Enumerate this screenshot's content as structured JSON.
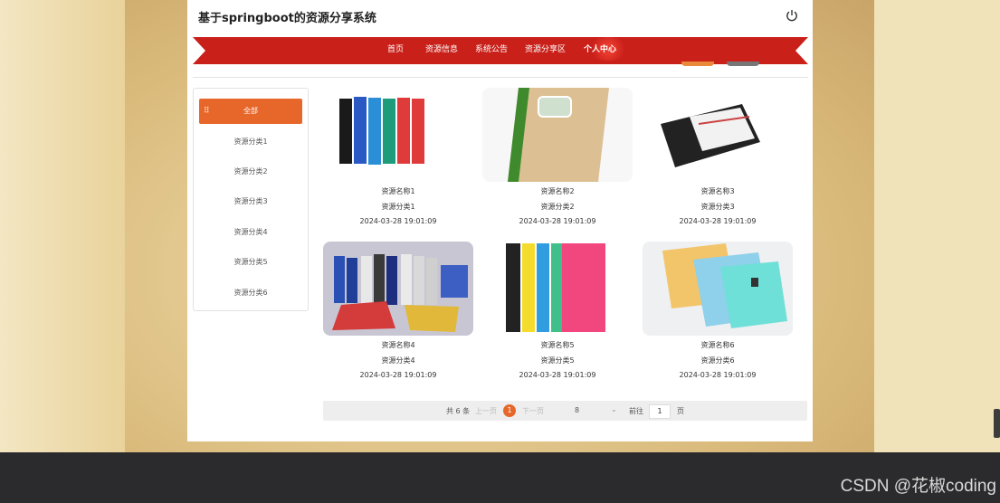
{
  "site": {
    "title": "基于springboot的资源分享系统"
  },
  "nav": {
    "items": [
      "首页",
      "资源信息",
      "系统公告",
      "资源分享区",
      "个人中心"
    ],
    "active": "个人中心"
  },
  "sidebar": {
    "items": [
      "全部",
      "资源分类1",
      "资源分类2",
      "资源分类3",
      "资源分类4",
      "资源分类5",
      "资源分类6"
    ],
    "active": "全部"
  },
  "cards": [
    {
      "name": "资源名称1",
      "category": "资源分类1",
      "time": "2024-03-28 19:01:09",
      "image": "binder-files-icon"
    },
    {
      "name": "资源名称2",
      "category": "资源分类2",
      "time": "2024-03-28 19:01:09",
      "image": "notebook-icon"
    },
    {
      "name": "资源名称3",
      "category": "资源分类3",
      "time": "2024-03-28 19:01:09",
      "image": "ring-binder-icon"
    },
    {
      "name": "资源名称4",
      "category": "资源分类4",
      "time": "2024-03-28 19:01:09",
      "image": "office-folders-icon"
    },
    {
      "name": "资源名称5",
      "category": "资源分类5",
      "time": "2024-03-28 19:01:09",
      "image": "colored-binders-icon"
    },
    {
      "name": "资源名称6",
      "category": "资源分类6",
      "time": "2024-03-28 19:01:09",
      "image": "document-bags-icon"
    }
  ],
  "pagination": {
    "total": "共 6 条",
    "prev": "上一页",
    "current": "1",
    "next": "下一页",
    "page_size": "8",
    "goto_label": "前往",
    "goto_value": "1",
    "page_suffix": "页"
  },
  "colors": {
    "accent": "#e7672a",
    "ribbon": "#c9201a"
  },
  "watermark": "CSDN @花椒coding"
}
